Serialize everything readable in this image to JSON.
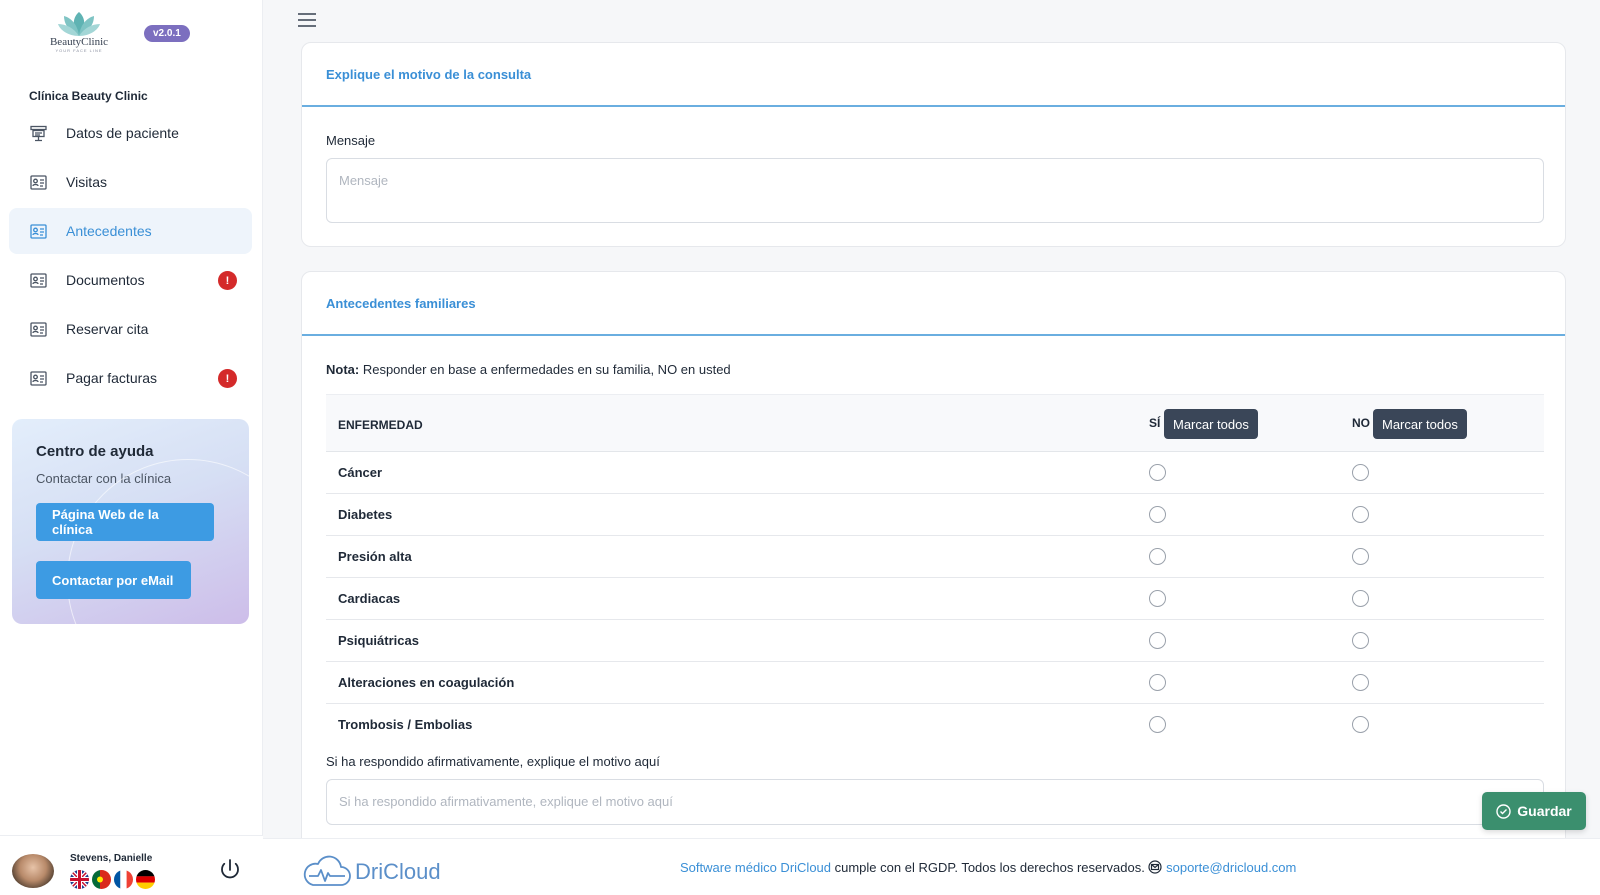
{
  "app": {
    "logo_text": "BeautyClinic",
    "logo_sub": "YOUR FACE LINE",
    "version": "v2.0.1",
    "clinic_name": "Clínica Beauty Clinic"
  },
  "sidebar": {
    "items": [
      {
        "label": "Datos de paciente",
        "icon": "patient-data-icon"
      },
      {
        "label": "Visitas",
        "icon": "id-card-icon"
      },
      {
        "label": "Antecedentes",
        "icon": "id-card-icon",
        "active": true
      },
      {
        "label": "Documentos",
        "icon": "id-card-icon",
        "alert": "!"
      },
      {
        "label": "Reservar cita",
        "icon": "id-card-icon"
      },
      {
        "label": "Pagar facturas",
        "icon": "id-card-icon",
        "alert": "!"
      }
    ]
  },
  "help": {
    "title": "Centro de ayuda",
    "subtitle": "Contactar con la clínica",
    "web_button": "Página Web de la clínica",
    "email_button": "Contactar por eMail"
  },
  "user": {
    "name": "Stevens, Danielle",
    "languages": [
      "en",
      "pt",
      "fr",
      "de"
    ]
  },
  "consulta": {
    "title": "Explique el motivo de la consulta",
    "message_label": "Mensaje",
    "message_placeholder": "Mensaje"
  },
  "familiares": {
    "title": "Antecedentes familiares",
    "note_bold": "Nota:",
    "note_text": " Responder en base a enfermedades en su familia, NO en usted",
    "headers": {
      "disease": "ENFERMEDAD",
      "yes": "SÍ",
      "no": "NO",
      "mark_all": "Marcar todos"
    },
    "diseases": [
      "Cáncer",
      "Diabetes",
      "Presión alta",
      "Cardiacas",
      "Psiquiátricas",
      "Alteraciones en coagulación",
      "Trombosis / Embolias"
    ],
    "explain_label": "Si ha respondido afirmativamente, explique el motivo aquí",
    "explain_placeholder": "Si ha respondido afirmativamente, explique el motivo aquí"
  },
  "actions": {
    "save": "Guardar"
  },
  "footer": {
    "brand": "DriCloud",
    "link_text": "Software médico DriCloud",
    "text": " cumple con el RGDP. Todos los derechos reservados. ",
    "email": "soporte@dricloud.com"
  },
  "colors": {
    "accent": "#3a8fd6",
    "save": "#3b8f6e",
    "alert": "#d42a2a",
    "version": "#7c6fbf"
  }
}
